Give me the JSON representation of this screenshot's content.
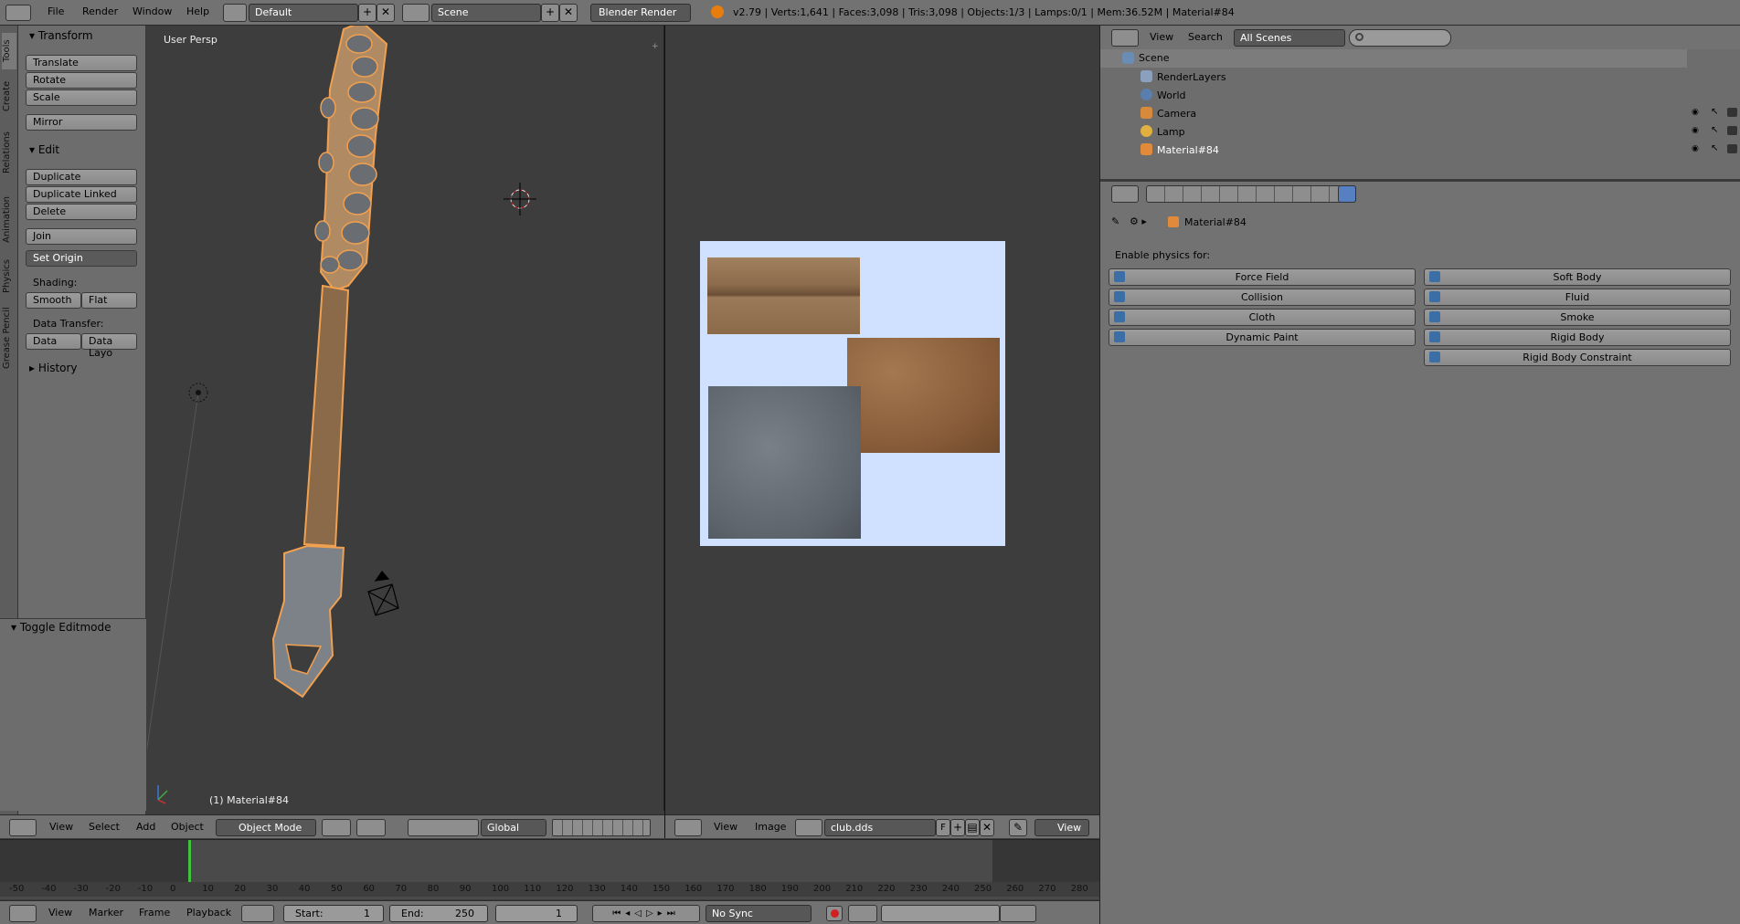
{
  "topbar": {
    "menus": [
      "File",
      "Render",
      "Window",
      "Help"
    ],
    "layout": "Default",
    "scene": "Scene",
    "engine": "Blender Render",
    "stats": "v2.79 | Verts:1,641 | Faces:3,098 | Tris:3,098 | Objects:1/3 | Lamps:0/1 | Mem:36.52M | Material#84"
  },
  "tabs": [
    "Tools",
    "Create",
    "Relations",
    "Animation",
    "Physics",
    "Grease Pencil"
  ],
  "toolshelf": {
    "transform_header": "Transform",
    "translate": "Translate",
    "rotate": "Rotate",
    "scale": "Scale",
    "mirror": "Mirror",
    "edit_header": "Edit",
    "duplicate": "Duplicate",
    "duplicate_linked": "Duplicate Linked",
    "delete": "Delete",
    "join": "Join",
    "set_origin": "Set Origin",
    "shading_label": "Shading:",
    "smooth": "Smooth",
    "flat": "Flat",
    "data_transfer_label": "Data Transfer:",
    "data": "Data",
    "data_layout": "Data Layo",
    "history_header": "History",
    "toggle_editmode": "Toggle Editmode"
  },
  "viewport": {
    "label": "User Persp",
    "object": "(1) Material#84"
  },
  "viewport_header": {
    "menus": [
      "View",
      "Select",
      "Add",
      "Object"
    ],
    "mode": "Object Mode",
    "orientation": "Global"
  },
  "image_header": {
    "menus": [
      "View",
      "Image"
    ],
    "image_name": "club.dds",
    "fake_user": "F",
    "view": "View"
  },
  "timeline": {
    "ticks": [
      "-50",
      "-40",
      "-30",
      "-20",
      "-10",
      "0",
      "10",
      "20",
      "30",
      "40",
      "50",
      "60",
      "70",
      "80",
      "90",
      "100",
      "110",
      "120",
      "130",
      "140",
      "150",
      "160",
      "170",
      "180",
      "190",
      "200",
      "210",
      "220",
      "230",
      "240",
      "250",
      "260",
      "270",
      "280"
    ],
    "menus": [
      "View",
      "Marker",
      "Frame",
      "Playback"
    ],
    "start_label": "Start:",
    "start_value": "1",
    "end_label": "End:",
    "end_value": "250",
    "current": "1",
    "sync": "No Sync"
  },
  "outliner": {
    "menus": [
      "View",
      "Search"
    ],
    "filter": "All Scenes",
    "rows": [
      {
        "name": "Scene"
      },
      {
        "name": "RenderLayers"
      },
      {
        "name": "World"
      },
      {
        "name": "Camera"
      },
      {
        "name": "Lamp"
      },
      {
        "name": "Material#84"
      }
    ]
  },
  "properties": {
    "breadcrumb": "Material#84",
    "enable_label": "Enable physics for:",
    "left_buttons": [
      "Force Field",
      "Collision",
      "Cloth",
      "Dynamic Paint"
    ],
    "right_buttons": [
      "Soft Body",
      "Fluid",
      "Smoke",
      "Rigid Body",
      "Rigid Body Constraint"
    ]
  },
  "colors": {
    "selection_outline": "#f0a050",
    "image_bg": "#d0e0ff",
    "wood": "#8a6a48",
    "stone": "#6a7078",
    "leather": "#9a7048"
  }
}
